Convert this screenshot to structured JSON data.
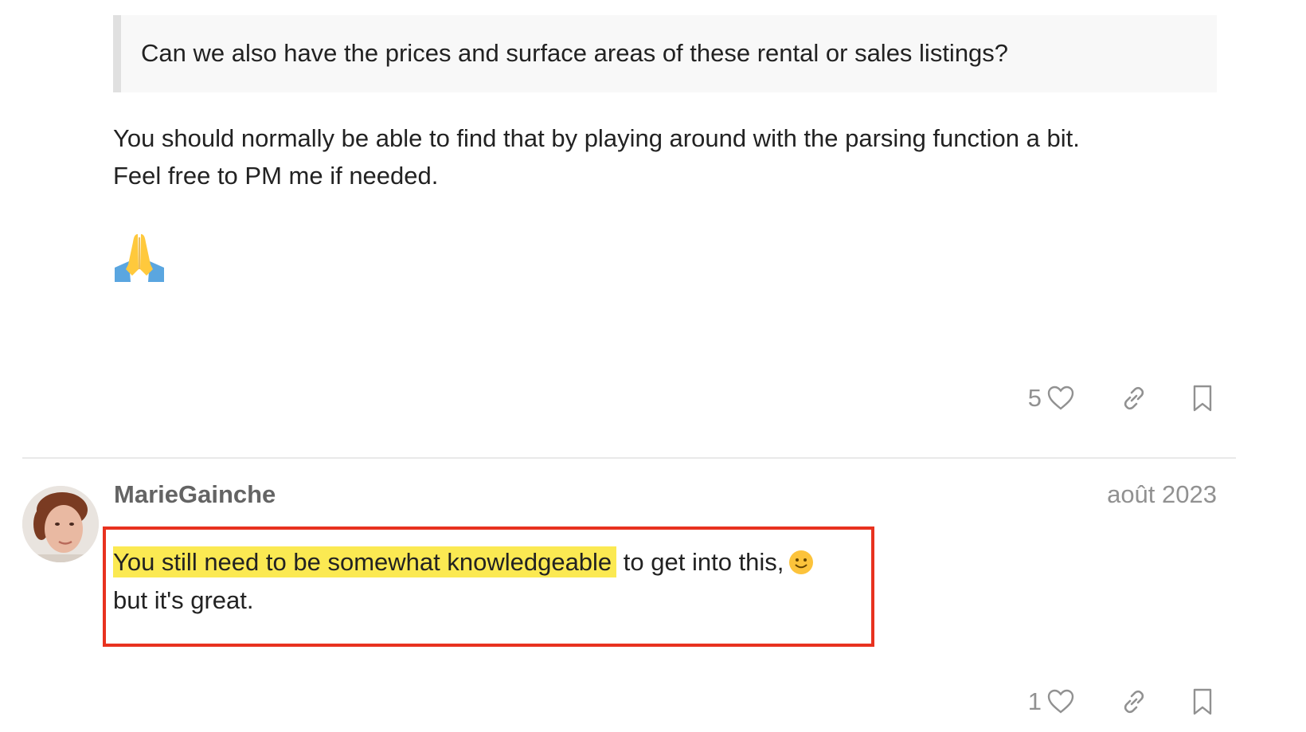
{
  "post1": {
    "quote": "Can we also have the prices and surface areas of these rental or sales listings?",
    "line1": "You should normally be able to find that by playing around with the parsing function a bit.",
    "line2": "Feel free to PM me if needed.",
    "emoji": "folded-hands",
    "likes": "5"
  },
  "post2": {
    "username": "MarieGainche",
    "date": "août 2023",
    "highlighted": "You still need to be somewhat knowledgeable",
    "rest_line1": " to get into this,",
    "line2": "but it's great.",
    "emoji": "slightly-smiling-face",
    "likes": "1"
  },
  "colors": {
    "highlight": "#fbe952",
    "annotation_box": "#e8321f",
    "quote_bg": "#f8f8f8",
    "meta_gray": "#919191"
  }
}
